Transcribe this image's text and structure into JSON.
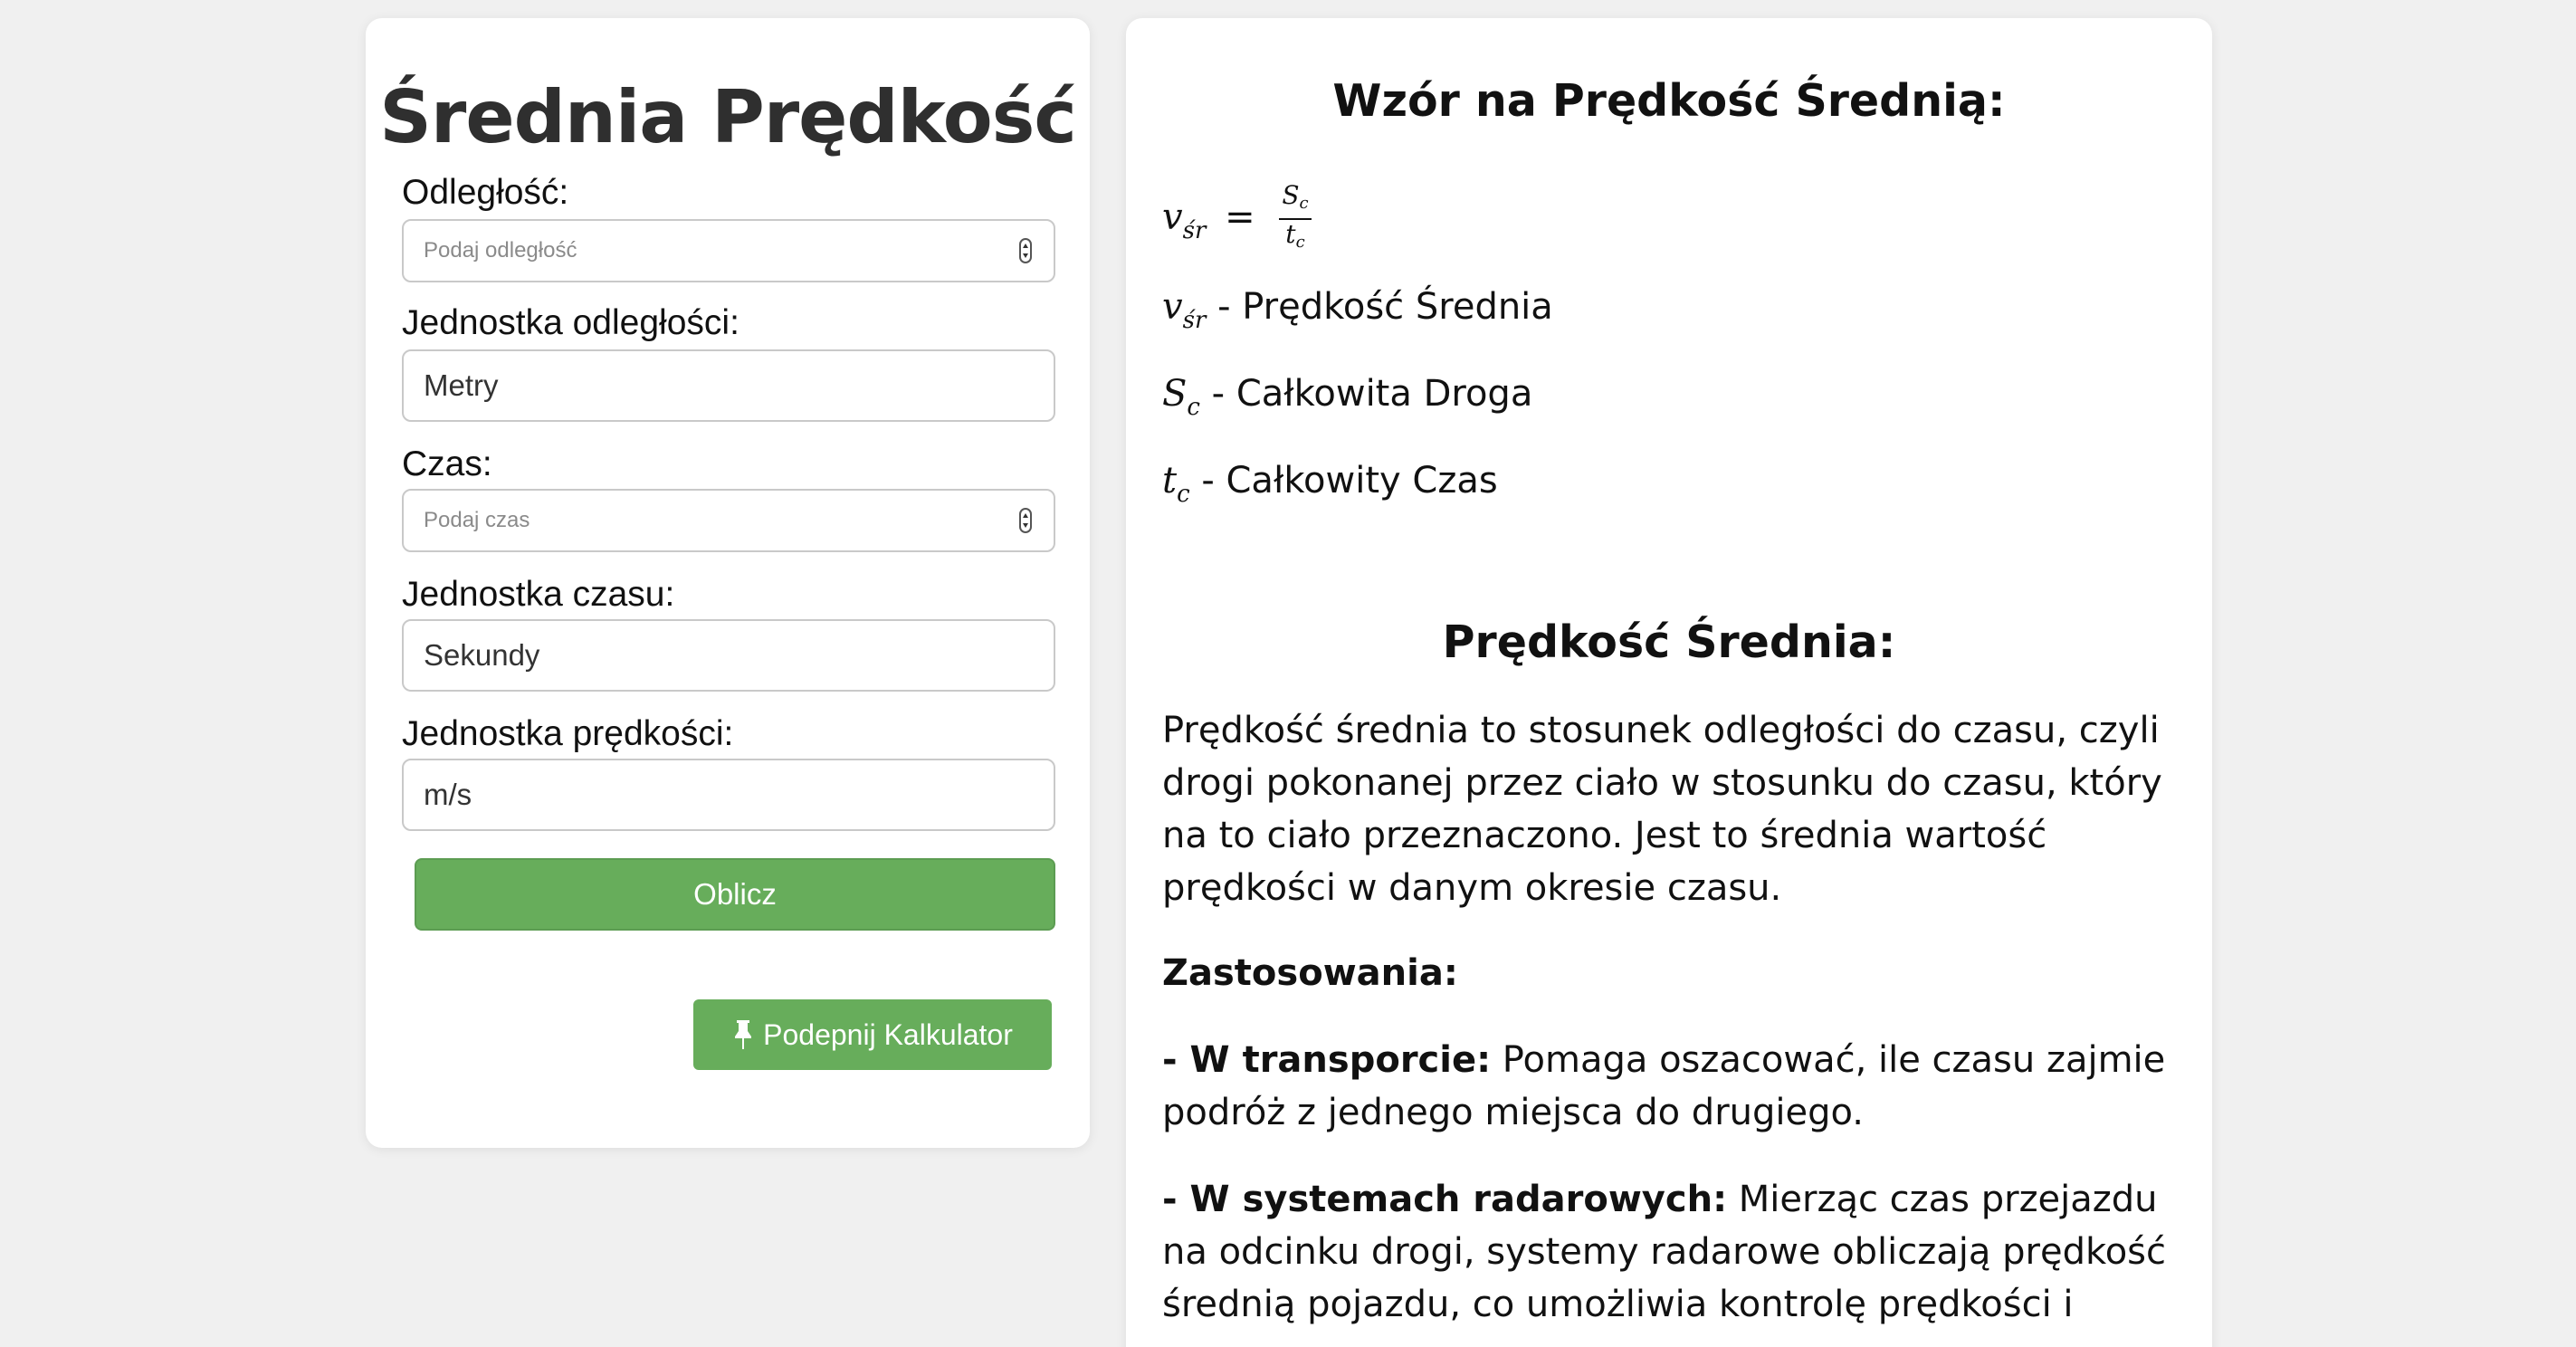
{
  "calculator": {
    "title": "Średnia Prędkość",
    "distance_label": "Odległość:",
    "distance_placeholder": "Podaj odległość",
    "distance_unit_label": "Jednostka odległości:",
    "distance_unit_value": "Metry",
    "time_label": "Czas:",
    "time_placeholder": "Podaj czas",
    "time_unit_label": "Jednostka czasu:",
    "time_unit_value": "Sekundy",
    "speed_unit_label": "Jednostka prędkości:",
    "speed_unit_value": "m/s",
    "calculate_button": "Oblicz",
    "pin_button": "Podepnij Kalkulator"
  },
  "info": {
    "formula_heading": "Wzór na Prędkość Średnią:",
    "formula": {
      "lhs_symbol": "v",
      "lhs_sub": "śr",
      "equals": "=",
      "numerator_symbol": "S",
      "numerator_sub": "c",
      "denominator_symbol": "t",
      "denominator_sub": "c"
    },
    "definitions": [
      {
        "symbol": "v",
        "sub": "śr",
        "text": " - Prędkość Średnia"
      },
      {
        "symbol": "S",
        "sub": "c",
        "text": " - Całkowita Droga"
      },
      {
        "symbol": "t",
        "sub": "c",
        "text": " - Całkowity Czas"
      }
    ],
    "section_heading": "Prędkość Średnia:",
    "description": "Prędkość średnia to stosunek odległości do czasu, czyli drogi pokonanej przez ciało w stosunku do czasu, który na to ciało przeznaczono. Jest to średnia wartość prędkości w danym okresie czasu.",
    "applications_heading": "Zastosowania:",
    "applications": [
      {
        "title": "- W transporcie:",
        "text": " Pomaga oszacować, ile czasu zajmie podróż z jednego miejsca do drugiego."
      },
      {
        "title": "- W systemach radarowych:",
        "text": " Mierząc czas przejazdu na odcinku drogi, systemy radarowe obliczają prędkość średnią pojazdu, co umożliwia kontrolę prędkości i"
      }
    ]
  }
}
